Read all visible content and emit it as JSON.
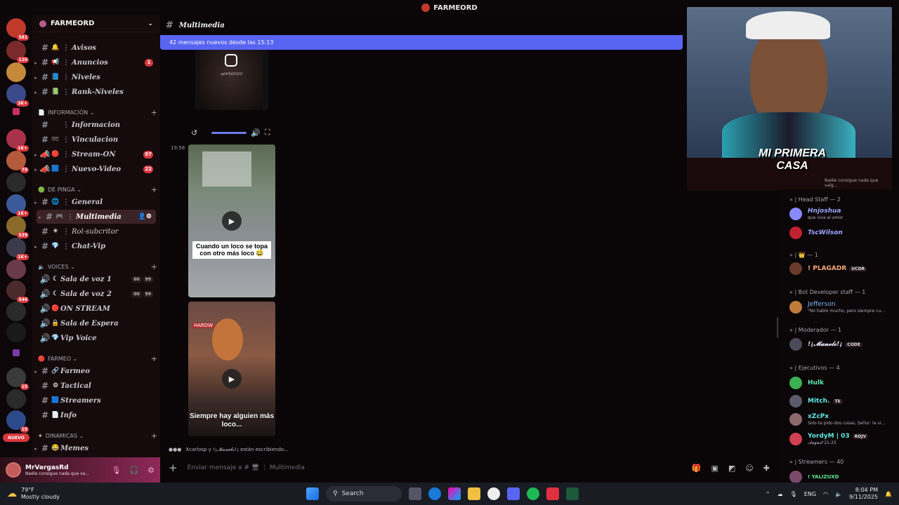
{
  "window": {
    "title": "FARMEORD"
  },
  "server_rail": {
    "badges": [
      "581",
      "120",
      "3K+",
      "1K+",
      "79",
      "1K+",
      "539",
      "1K+",
      "546",
      "19",
      "15",
      "NUEVO"
    ]
  },
  "sidebar": {
    "server_name": "FARMEORD",
    "channels_top": [
      {
        "emoji": "🔔",
        "name": "Avisos"
      },
      {
        "emoji": "📢",
        "name": "Anuncios",
        "count": "1"
      },
      {
        "emoji": "📘",
        "name": "Niveles"
      },
      {
        "emoji": "📗",
        "name": "Rank-Niveles"
      }
    ],
    "cat_informacion": "INFORMACIÓN",
    "channels_info": [
      {
        "emoji": "",
        "name": "Informacion"
      },
      {
        "emoji": "➿",
        "name": "Vinculacion"
      },
      {
        "emoji": "🔴",
        "name": "Stream-ON",
        "count": "97"
      },
      {
        "emoji": "🟦",
        "name": "Nuevo-Video",
        "count": "22"
      }
    ],
    "cat_depinga": "DE PINGA",
    "channels_depinga": [
      {
        "emoji": "🌐",
        "name": "General"
      },
      {
        "emoji": "🎮",
        "name": "Multimedia"
      },
      {
        "emoji": "✴",
        "name": "Rol-subcritor"
      },
      {
        "emoji": "💎",
        "name": "Chat-Vip"
      }
    ],
    "cat_voices": "VOICES",
    "channels_voice": [
      {
        "emoji": "☾",
        "name": "Sala de voz 1",
        "a": "00",
        "b": "99"
      },
      {
        "emoji": "☾",
        "name": "Sala de voz 2",
        "a": "00",
        "b": "99"
      },
      {
        "emoji": "🔴",
        "name": "ON STREAM"
      },
      {
        "emoji": "🔒",
        "name": "Sala de Espera"
      },
      {
        "emoji": "💎",
        "name": "Vip Voice"
      }
    ],
    "cat_farmeo": "FARMEO",
    "channels_farmeo": [
      {
        "emoji": "🔗",
        "name": "Farmeo"
      },
      {
        "emoji": "⚙",
        "name": "Tactical"
      },
      {
        "emoji": "🟦",
        "name": "Streamers"
      },
      {
        "emoji": "📄",
        "name": "Info"
      }
    ],
    "cat_dinamicas": "DINAMICAS",
    "channels_dinamicas": [
      {
        "emoji": "😂",
        "name": "Memes"
      }
    ]
  },
  "user": {
    "name": "MrVargasRd",
    "status": "Nadie consigue nada que va..."
  },
  "channel": {
    "name": "Multimedia"
  },
  "banner": {
    "text": "42 mensajes nuevos desde las 15:13"
  },
  "messages": {
    "timestamp": "19:58",
    "instagram_handle": "@P4TRIOT2557",
    "caption1": "Cuando un loco se topa con otro más loco 😂",
    "caption2": "Siempre hay alguien más loco...",
    "sign_text": "HARDW"
  },
  "typing": {
    "text": "Xcarlosp y !¡𝓜𝓪𝓷𝓮𝓵𝓸!¡ están escribiendo..."
  },
  "composer": {
    "placeholder": "Enviar mensaje a # 🖥 ⋮ Multimedia"
  },
  "webcam": {
    "overlay_title": "MI PRIMERA CASA",
    "ticker": "Nadie consigue nada que valg..."
  },
  "members": {
    "cat_head": "» | Head Staff — 2",
    "m1_name": "Hnjoshua",
    "m1_status": "que viva el amor",
    "m2_name": "TscWilson",
    "cat_crown": "» | 👑 — 1",
    "m3_name": "! PLAGADR",
    "m3_tag": "UCDR",
    "cat_bot": "» | Bot Developer staff — 1",
    "m4_name": "Jefferson",
    "m4_status": "\"No hablo mucho, pero siempre cu...",
    "cat_mod": "» | Moderador — 1",
    "m5_name": "!¡𝓜𝓪𝓷𝓮𝓵𝓸!¡",
    "m5_tag": "CODE",
    "cat_ejec": "» | Ejecutivos — 4",
    "m6_name": "Hulk",
    "m7_name": "Mitch.",
    "m7_tag": "Tk",
    "m8_name": "xZcPx",
    "m8_status": "Solo te pido dos cosas, Señor: la vi...",
    "m9_name": "YordyM | 03",
    "m9_tag": "RDJV",
    "m9_status": "𝓐𝓾𝓰𝓾𝓼𝓽 21-25",
    "cat_streamers": "» | Streamers — 40",
    "m10_name": "! YALIZUXD"
  },
  "taskbar": {
    "temp": "79°F",
    "weather": "Mostly cloudy",
    "search": "Search",
    "lang": "ENG",
    "time": "8:04 PM",
    "date": "9/11/2025"
  },
  "colors": {
    "accent": "#5865f2",
    "badge": "#d9363e",
    "background": "#0a0608"
  }
}
